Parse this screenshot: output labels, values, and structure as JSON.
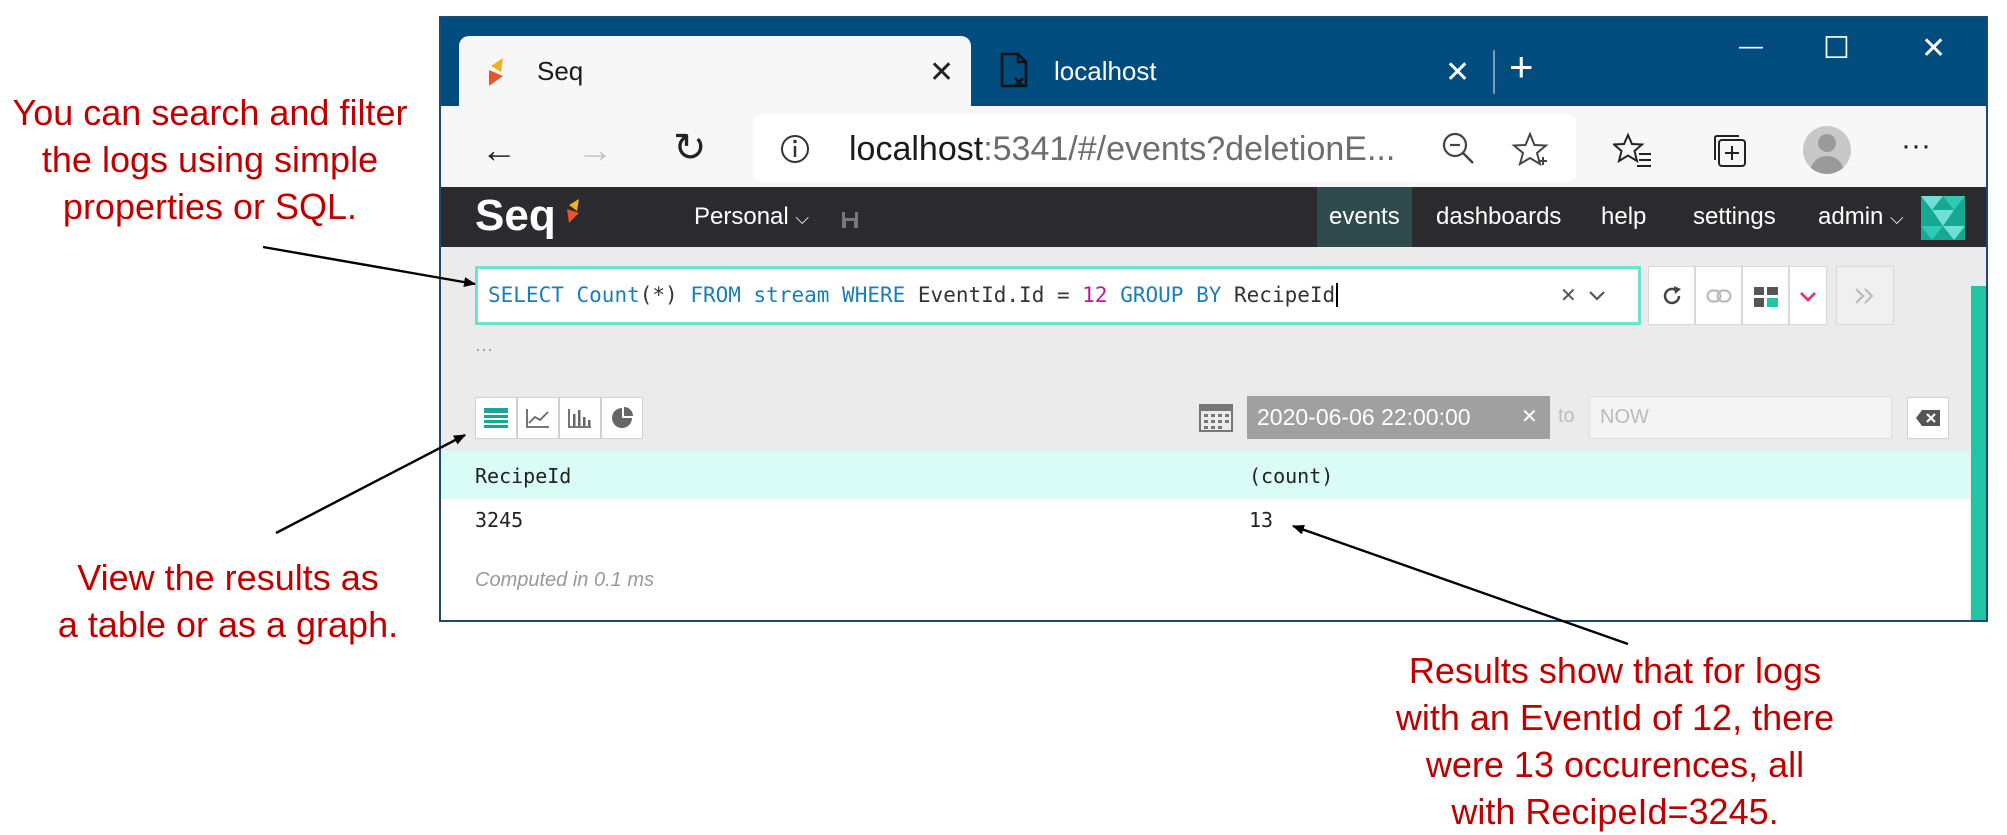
{
  "annotations": {
    "search": [
      "You can search and filter",
      "the logs using simple",
      "properties or SQL."
    ],
    "view": [
      "View the results as",
      "a table or as a graph."
    ],
    "results": [
      "Results show that for logs",
      "with an EventId of 12, there",
      "were 13 occurences, all",
      "with RecipeId=3245."
    ]
  },
  "browser": {
    "tabs": [
      {
        "title": "Seq",
        "close": "✕"
      },
      {
        "title": "localhost",
        "close": "✕"
      }
    ],
    "new_tab": "+",
    "window": {
      "minimize": "—",
      "maximize": "☐",
      "close": "✕"
    },
    "nav": {
      "back": "←",
      "forward": "→",
      "refresh": "↻"
    },
    "address": {
      "host": "localhost",
      "rest": ":5341/#/events?deletionE..."
    },
    "icons": [
      "info-icon",
      "zoom-out-icon",
      "favorite-star-icon",
      "favorites-list-icon",
      "collections-icon",
      "profile-avatar",
      "more-menu-icon"
    ],
    "more": "···"
  },
  "seq": {
    "logo": "Seq",
    "workspace": "Personal",
    "nav": [
      {
        "label": "events",
        "active": true
      },
      {
        "label": "dashboards",
        "active": false
      },
      {
        "label": "help",
        "active": false
      },
      {
        "label": "settings",
        "active": false
      },
      {
        "label": "admin",
        "active": false
      }
    ],
    "query": {
      "parts": [
        {
          "t": "SELECT ",
          "k": "kw"
        },
        {
          "t": "Count",
          "k": "kw"
        },
        {
          "t": "(*) ",
          "k": "plain"
        },
        {
          "t": "FROM ",
          "k": "kw"
        },
        {
          "t": "stream ",
          "k": "kw"
        },
        {
          "t": "WHERE ",
          "k": "kw"
        },
        {
          "t": "EventId.Id = ",
          "k": "plain"
        },
        {
          "t": "12 ",
          "k": "num"
        },
        {
          "t": "GROUP BY ",
          "k": "kw"
        },
        {
          "t": "RecipeId",
          "k": "plain"
        }
      ],
      "clear": "✕",
      "expand": "⌄"
    },
    "ellipsis": "···",
    "date_from": "2020-06-06 22:00:00",
    "date_clear": "✕",
    "to_label": "to",
    "date_to_placeholder": "NOW",
    "results": {
      "columns": [
        "RecipeId",
        "(count)"
      ],
      "rows": [
        [
          "3245",
          "13"
        ]
      ],
      "computed": "Computed in 0.1 ms"
    },
    "colors": {
      "accent": "#1ec6a6",
      "query_border": "#6fe0d3",
      "keyword": "#1a7fb8",
      "number": "#c2189b",
      "annotation": "#c00000"
    }
  }
}
